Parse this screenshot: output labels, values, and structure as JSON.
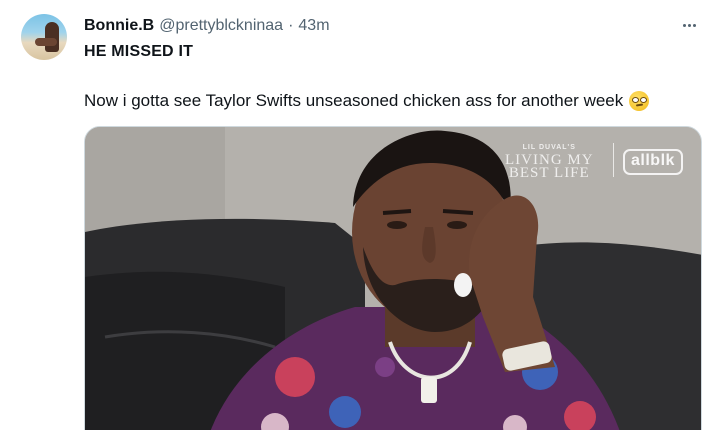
{
  "tweet": {
    "author_name": "Bonnie.B",
    "handle": "@prettyblckninaa",
    "separator": "·",
    "time": "43m",
    "text_line1": "HE MISSED IT",
    "text_line2": "Now i gotta see Taylor Swifts unseasoned chicken ass for another week",
    "emoji": "face-with-rolling-eyes"
  },
  "media": {
    "watermark_small": "LIL DUVAL'S",
    "watermark_line1": "LIVING MY",
    "watermark_line2": "BEST LIFE",
    "brand": "allblk"
  },
  "colors": {
    "text_primary": "#0f1419",
    "text_secondary": "#536471",
    "border": "#cfd9de"
  }
}
